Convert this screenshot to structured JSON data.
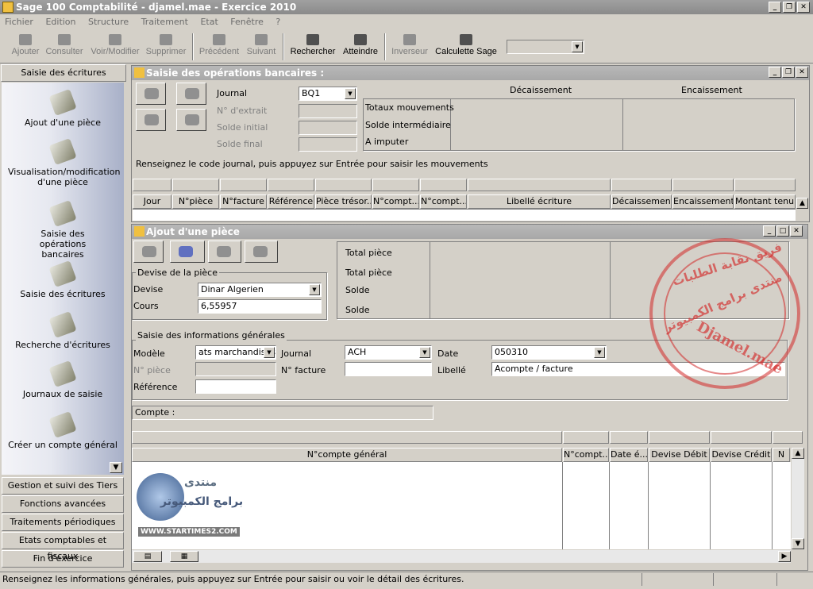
{
  "app": {
    "title": "Sage 100 Comptabilité - djamel.mae - Exercice 2010"
  },
  "menu": [
    "Fichier",
    "Edition",
    "Structure",
    "Traitement",
    "Etat",
    "Fenêtre",
    "?"
  ],
  "toolbar": {
    "ajouter": "Ajouter",
    "consulter": "Consulter",
    "voir": "Voir/Modifier",
    "supprimer": "Supprimer",
    "precedent": "Précédent",
    "suivant": "Suivant",
    "rechercher": "Rechercher",
    "atteindre": "Atteindre",
    "inverseur": "Inverseur",
    "calculette": "Calculette Sage"
  },
  "sidebar": {
    "header": "Saisie des écritures",
    "items": [
      "Ajout d'une pièce",
      "Visualisation/modification d'une pièce",
      "Saisie des opérations bancaires",
      "Saisie des écritures",
      "Recherche d'écritures",
      "Journaux de saisie",
      "Créer un compte général"
    ],
    "footer": [
      "Gestion et suivi des Tiers",
      "Fonctions avancées",
      "Traitements périodiques",
      "Etats comptables et fiscaux",
      "Fin d'exercice"
    ]
  },
  "bank": {
    "title": "Saisie des opérations bancaires :",
    "journal_label": "Journal",
    "journal_value": "BQ1",
    "extrait_label": "N° d'extrait",
    "solde_initial_label": "Solde initial",
    "solde_final_label": "Solde final",
    "decaissement": "Décaissement",
    "encaissement": "Encaissement",
    "totaux": "Totaux mouvements",
    "solde_inter": "Solde intermédiaire",
    "a_imputer": "A imputer",
    "hint": "Renseignez le code journal, puis appuyez sur Entrée pour saisir les mouvements",
    "columns": [
      "Jour",
      "N°pièce",
      "N°facture",
      "Référence",
      "Pièce trésor...",
      "N°compt...",
      "N°compt...",
      "Libellé écriture",
      "Décaissement",
      "Encaissement",
      "Montant tenu..."
    ]
  },
  "piece": {
    "title": "Ajout d'une pièce",
    "devise_group": "Devise de la pièce",
    "devise_label": "Devise",
    "devise_value": "Dinar Algerien",
    "cours_label": "Cours",
    "cours_value": "6,55957",
    "total1": "Total pièce",
    "total2": "Total pièce",
    "solde1": "Solde",
    "solde2": "Solde",
    "info_group": "Saisie des informations générales",
    "modele_label": "Modèle",
    "modele_value": "ats marchandises",
    "npiece_label": "N° pièce",
    "reference_label": "Référence",
    "journal_label": "Journal",
    "journal_value": "ACH",
    "nfacture_label": "N° facture",
    "date_label": "Date",
    "date_value": "050310",
    "libelle_label": "Libellé",
    "libelle_value": "Acompte / facture",
    "compte_label": "Compte :",
    "columns": [
      "N°compte général",
      "N°compt...",
      "Date é...",
      "Devise Débit",
      "Devise Crédit",
      "N"
    ]
  },
  "status": {
    "text": "Renseignez les informations générales, puis appuyez sur Entrée pour saisir ou voir le détail des écritures."
  },
  "watermark": {
    "line1": "فريق نقابة الطلبات",
    "line2": "منتدى برامج الكمبيوتر",
    "name": "Djamel.mae"
  },
  "logo": {
    "line1": "منتدى",
    "line2": "برامج الكمبيوتر",
    "url": "WWW.STARTIMES2.COM"
  }
}
